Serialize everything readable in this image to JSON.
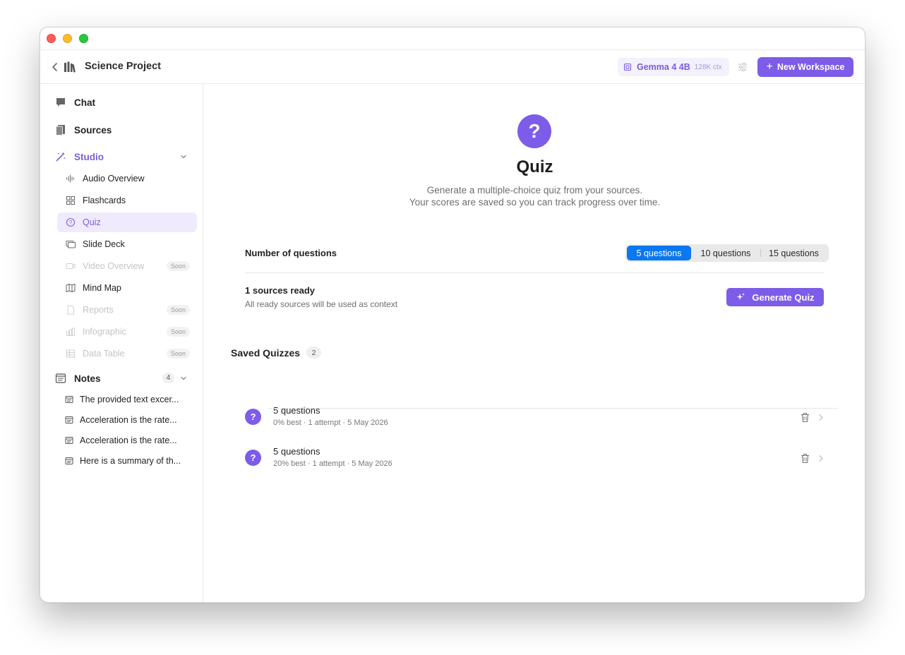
{
  "header": {
    "project_title": "Science Project",
    "model_name": "Gemma 4 4B",
    "model_ctx": "128K ctx",
    "new_workspace_label": "New Workspace"
  },
  "sidebar": {
    "chat_label": "Chat",
    "sources_label": "Sources",
    "studio_label": "Studio",
    "studio_items": [
      {
        "label": "Audio Overview"
      },
      {
        "label": "Flashcards"
      },
      {
        "label": "Quiz"
      },
      {
        "label": "Slide Deck"
      },
      {
        "label": "Video Overview",
        "badge": "Soon"
      },
      {
        "label": "Mind Map"
      },
      {
        "label": "Reports",
        "badge": "Soon"
      },
      {
        "label": "Infographic",
        "badge": "Soon"
      },
      {
        "label": "Data Table",
        "badge": "Soon"
      }
    ],
    "notes_label": "Notes",
    "notes_count": "4",
    "notes": [
      "The provided text excer...",
      "Acceleration is the rate...",
      "Acceleration is the rate...",
      "Here is a summary of th..."
    ]
  },
  "main": {
    "icon_glyph": "?",
    "title": "Quiz",
    "description_line1": "Generate a multiple-choice quiz from your sources.",
    "description_line2": "Your scores are saved so you can track progress over time.",
    "num_questions_label": "Number of questions",
    "question_options": [
      "5 questions",
      "10 questions",
      "15 questions"
    ],
    "selected_option": "5 questions",
    "sources_ready": "1 sources ready",
    "sources_subtext": "All ready sources will be used as context",
    "generate_label": "Generate Quiz",
    "saved_title": "Saved Quizzes",
    "saved_count": "2",
    "saved_quizzes": [
      {
        "title": "5 questions",
        "meta": "0% best · 1 attempt · 5 May 2026"
      },
      {
        "title": "5 questions",
        "meta": "20% best · 1 attempt · 5 May 2026"
      }
    ]
  },
  "colors": {
    "accent": "#7c5ce8",
    "selected_segment": "#0a78f0"
  }
}
